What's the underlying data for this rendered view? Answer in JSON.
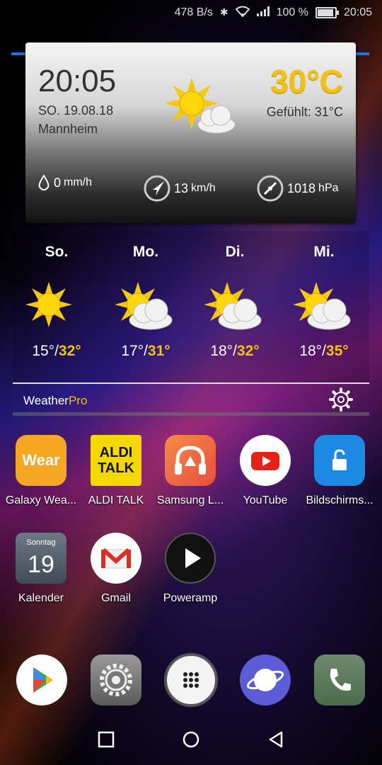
{
  "status_bar": {
    "net_speed": "478 B/s",
    "battery_pct": "100 %",
    "battery_level": 1.0,
    "time": "20:05",
    "icons": [
      "bluetooth-icon",
      "wifi-icon",
      "signal-icon",
      "battery-icon"
    ]
  },
  "weather_widget": {
    "time": "20:05",
    "date": "SO. 19.08.18",
    "city": "Mannheim",
    "temperature": "30°C",
    "feels_like": "Gefühlt: 31°C",
    "rain_value": "0",
    "rain_unit": "mm/h",
    "wind_value": "13",
    "wind_unit": "km/h",
    "pressure_value": "1018",
    "pressure_unit": "hPa"
  },
  "forecast": {
    "days": [
      {
        "name": "So.",
        "low": "15°",
        "high": "32°",
        "icon": "sun-icon"
      },
      {
        "name": "Mo.",
        "low": "17°",
        "high": "31°",
        "icon": "sun-cloud-icon"
      },
      {
        "name": "Di.",
        "low": "18°",
        "high": "32°",
        "icon": "sun-cloud-icon"
      },
      {
        "name": "Mi.",
        "low": "18°",
        "high": "35°",
        "icon": "sun-cloud-icon"
      }
    ],
    "brand_main": "Weather",
    "brand_accent": "Pro"
  },
  "apps_row1": [
    {
      "label": "Galaxy Wea...",
      "icon": "wear-icon",
      "icon_text": "Wear",
      "color": "#f5a623"
    },
    {
      "label": "ALDI TALK",
      "icon": "aldi-talk-icon",
      "icon_text": "ALDI TALK",
      "color": "#f5d800"
    },
    {
      "label": "Samsung L...",
      "icon": "headphones-icon",
      "color": "#ef6c3f"
    },
    {
      "label": "YouTube",
      "icon": "youtube-icon",
      "color": "#ffffff"
    },
    {
      "label": "Bildschirms...",
      "icon": "lock-icon",
      "color": "#1e88e5"
    }
  ],
  "apps_row2": [
    {
      "label": "Kalender",
      "icon": "calendar-icon",
      "icon_text_top": "Sonntag",
      "icon_text_day": "19"
    },
    {
      "label": "Gmail",
      "icon": "gmail-icon"
    },
    {
      "label": "Poweramp",
      "icon": "play-icon"
    }
  ],
  "dock": [
    "play-store-icon",
    "settings-icon",
    "app-drawer-icon",
    "internet-icon",
    "phone-icon"
  ],
  "colors": {
    "accent": "#f3c20c",
    "blue_line": "#1a73e8"
  }
}
